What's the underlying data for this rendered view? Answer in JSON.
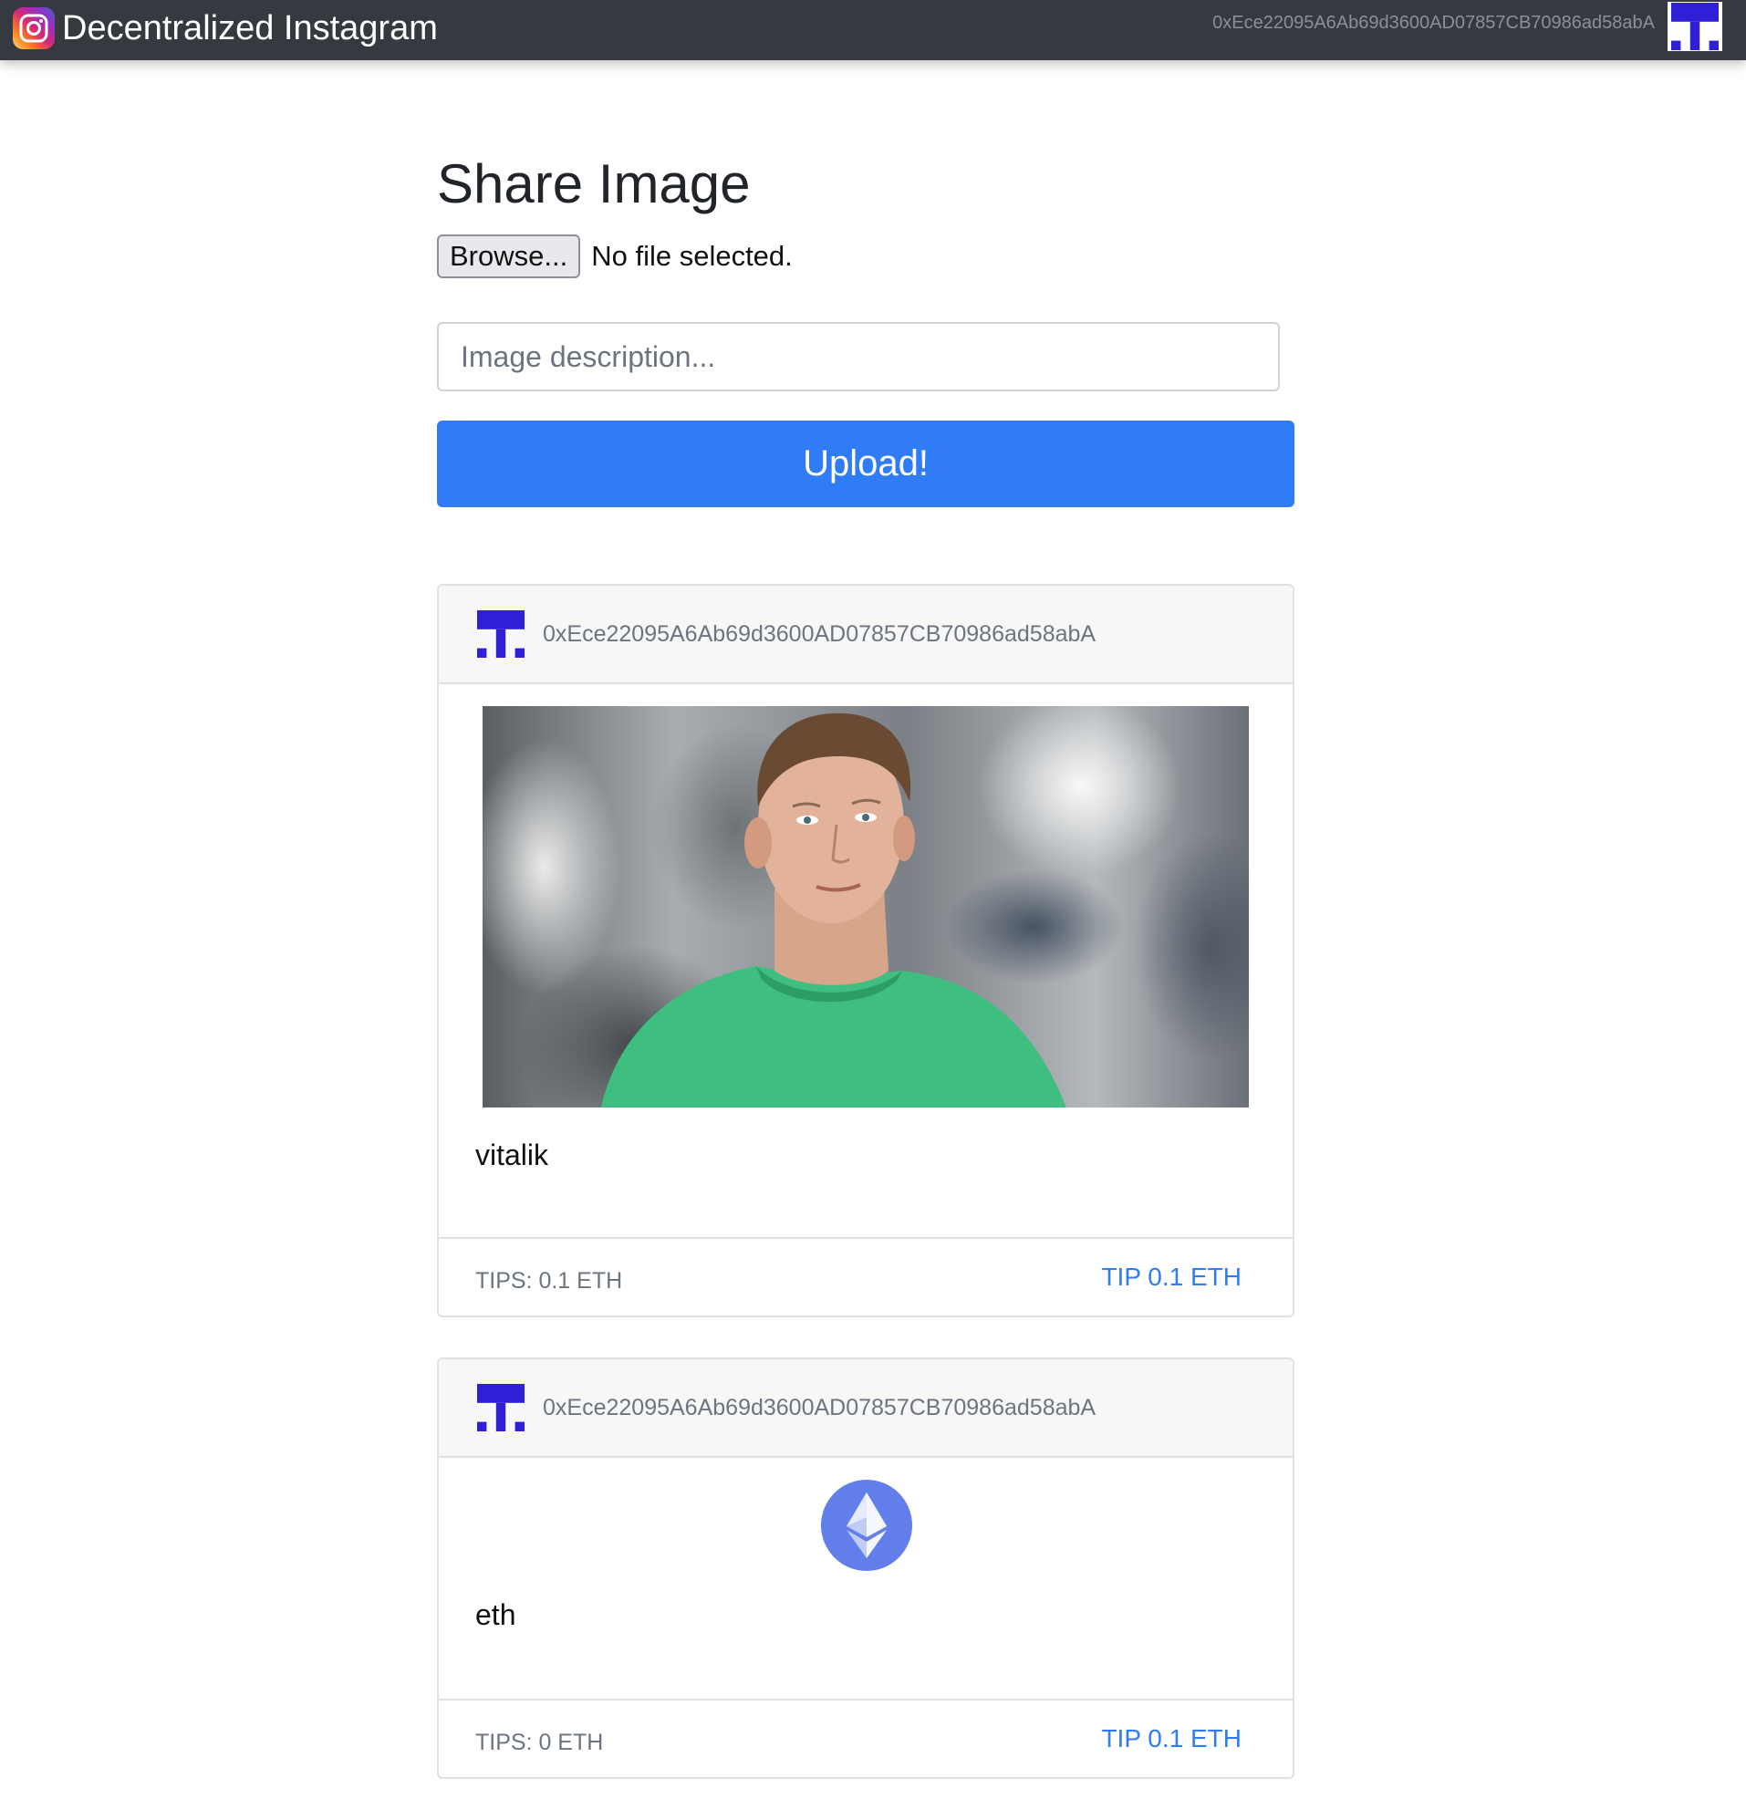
{
  "app": {
    "title": "Decentralized Instagram",
    "account": "0xEce22095A6Ab69d3600AD07857CB70986ad58abA",
    "brand_icon": "instagram-icon",
    "avatar_icon": "identicon-avatar"
  },
  "share": {
    "title": "Share Image",
    "browse_label": "Browse...",
    "file_status": "No file selected.",
    "description_placeholder": "Image description...",
    "description_value": "",
    "upload_label": "Upload!"
  },
  "posts": [
    {
      "author": "0xEce22095A6Ab69d3600AD07857CB70986ad58abA",
      "caption": "vitalik",
      "tips": "TIPS: 0.1 ETH",
      "tip_label": "TIP 0.1 ETH",
      "image": "photo of person in green t-shirt"
    },
    {
      "author": "0xEce22095A6Ab69d3600AD07857CB70986ad58abA",
      "caption": "eth",
      "tips": "TIPS: 0 ETH",
      "tip_label": "TIP 0.1 ETH",
      "image": "ethereum-logo"
    }
  ],
  "colors": {
    "navbar": "#343a40",
    "primary": "#2f7cf6",
    "identicon": "#2f1fd6",
    "eth_circle": "#627eea"
  }
}
